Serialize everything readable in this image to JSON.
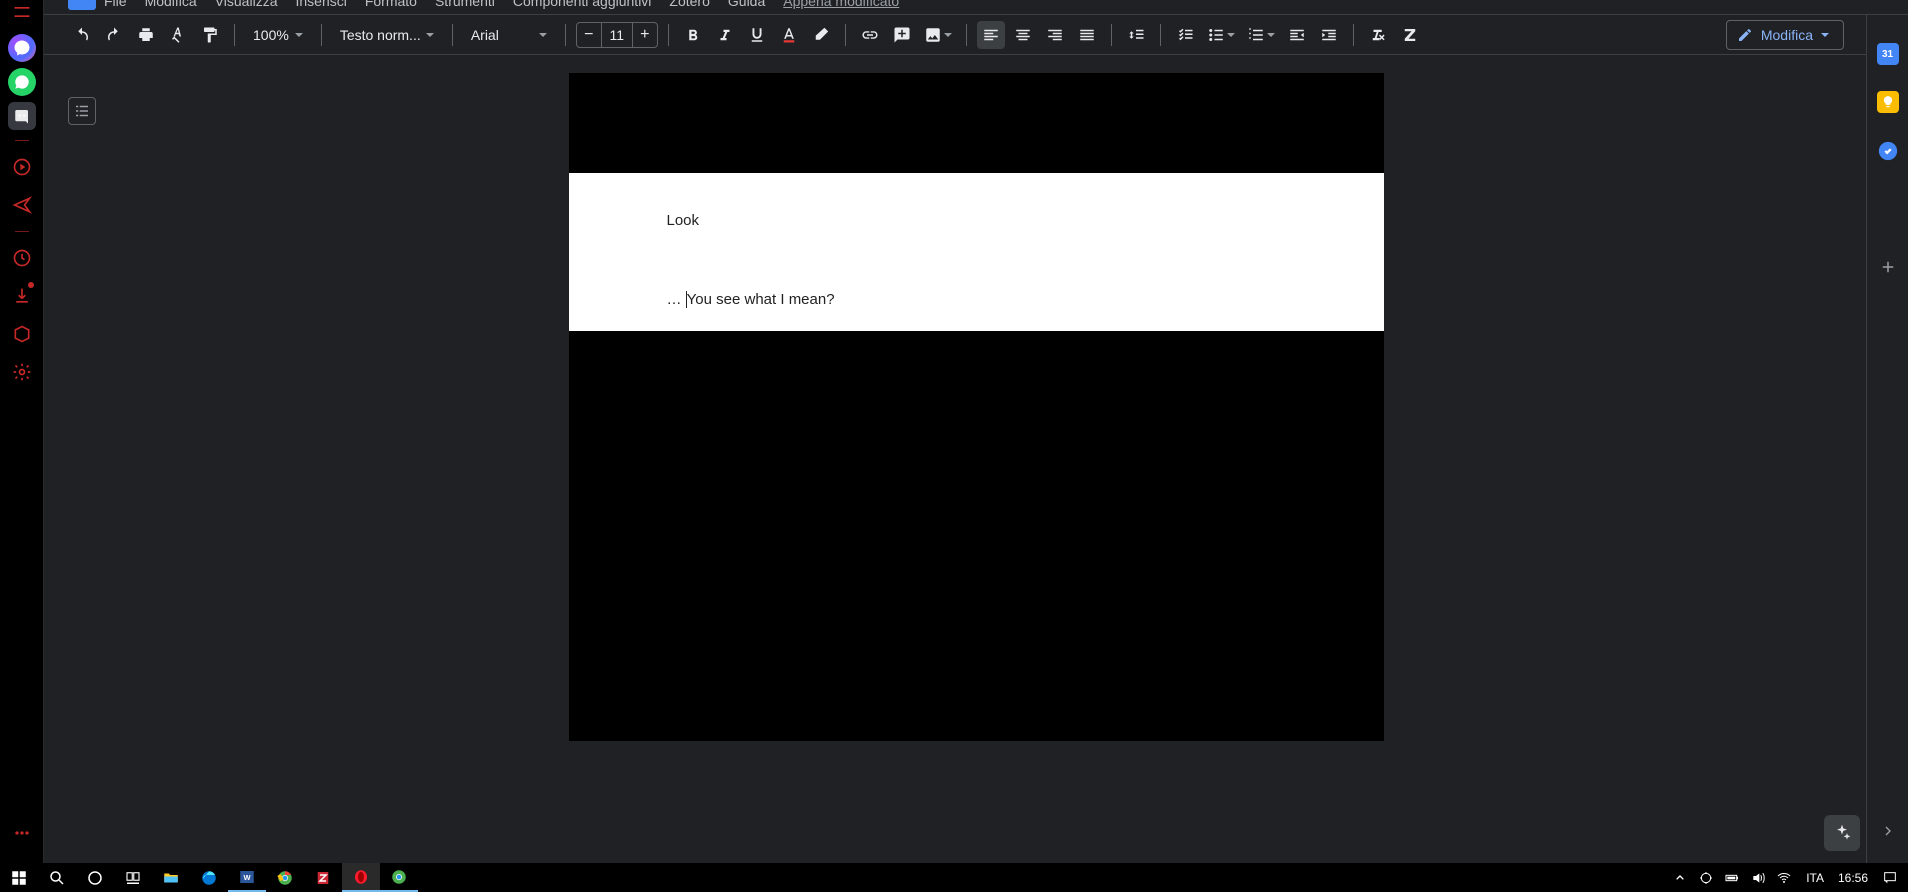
{
  "menu": {
    "items": [
      "File",
      "Modifica",
      "Visualizza",
      "Inserisci",
      "Formato",
      "Strumenti",
      "Componenti aggiuntivi",
      "Zotero",
      "Guida"
    ],
    "edited": "Appena modificato"
  },
  "toolbar": {
    "zoom": "100%",
    "style": "Testo norm...",
    "font": "Arial",
    "font_size": "11",
    "edit_mode": "Modifica"
  },
  "document": {
    "line1": "Look",
    "line2_prefix": "…",
    "line2_rest": "You see what I mean?"
  },
  "taskbar": {
    "lang": "ITA",
    "time": "16:56"
  },
  "side": {
    "calendar_day": "31"
  }
}
